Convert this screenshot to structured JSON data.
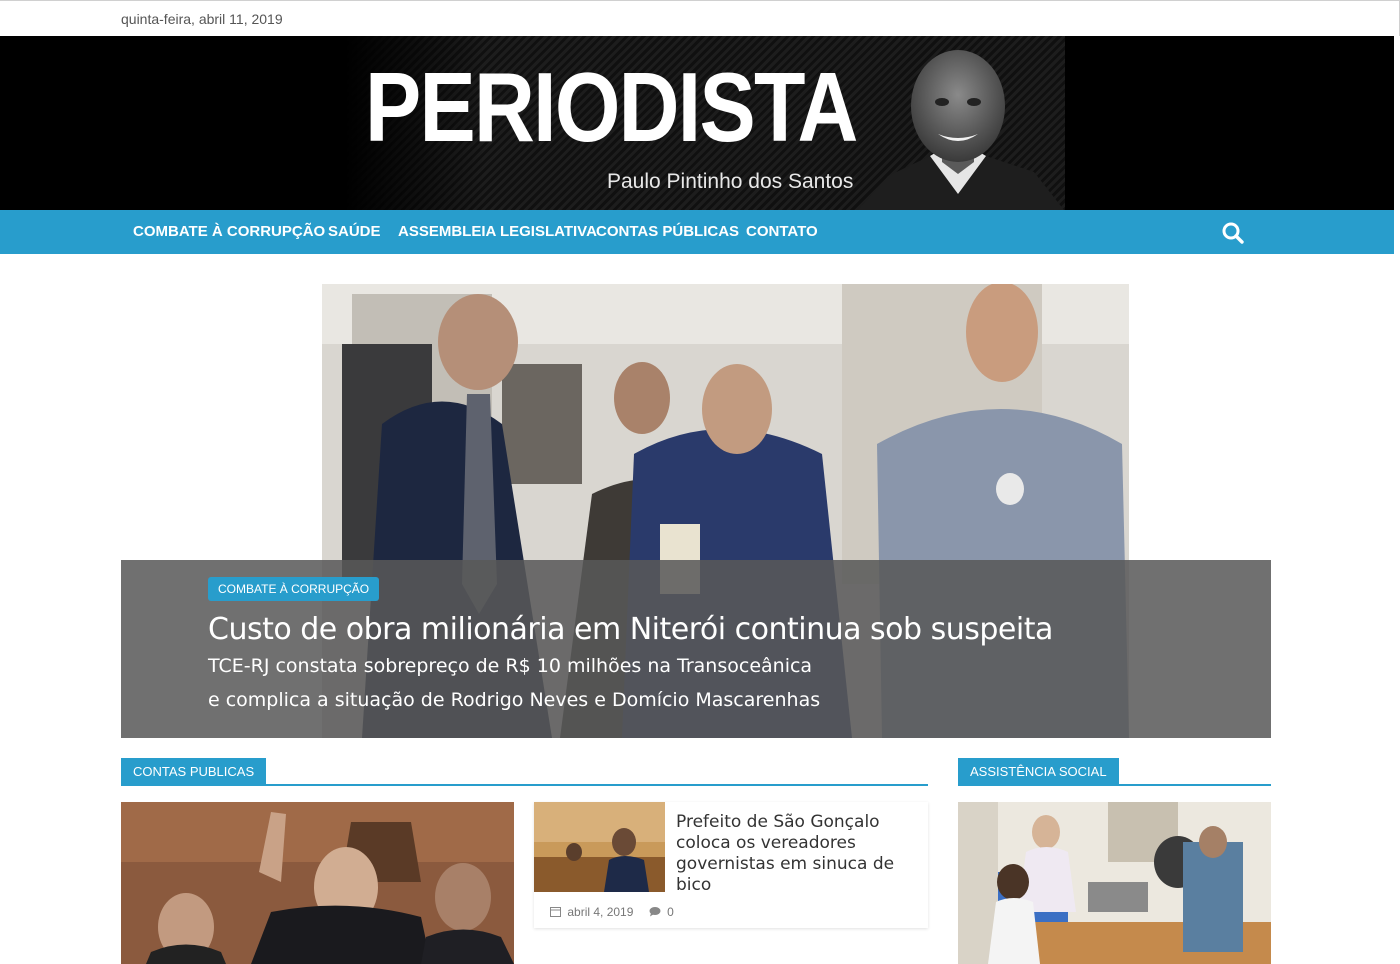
{
  "topbar": {
    "date": "quinta-feira, abril 11, 2019"
  },
  "header": {
    "logo_title": "PERIODISTA",
    "logo_subtitle": "Paulo Pintinho dos Santos"
  },
  "nav": {
    "items": [
      {
        "label": "COMBATE À CORRUPÇÃO"
      },
      {
        "label": "SAÚDE"
      },
      {
        "label": "ASSEMBLEIA LEGISLATIVA"
      },
      {
        "label": "CONTAS PÚBLICAS"
      },
      {
        "label": "CONTATO"
      }
    ],
    "search_icon": "search-icon"
  },
  "hero": {
    "category": "COMBATE À CORRUPÇÃO",
    "title": "Custo de obra milionária em Niterói continua sob suspeita",
    "subtitle_line1": "TCE-RJ constata sobrepreço de R$ 10 milhões na Transoceânica",
    "subtitle_line2": "e complica a situação de Rodrigo Neves e Domício Mascarenhas"
  },
  "sections": {
    "contas": {
      "label": "CONTAS PUBLICAS"
    },
    "assistencia": {
      "label": "ASSISTÊNCIA SOCIAL"
    }
  },
  "post": {
    "title": "Prefeito de São Gonçalo coloca os vereadores governistas em sinuca de bico",
    "date": "abril 4, 2019",
    "comments": "0"
  },
  "colors": {
    "accent": "#289dcc",
    "banner_bg": "#000000",
    "caption_bg": "#585858"
  }
}
